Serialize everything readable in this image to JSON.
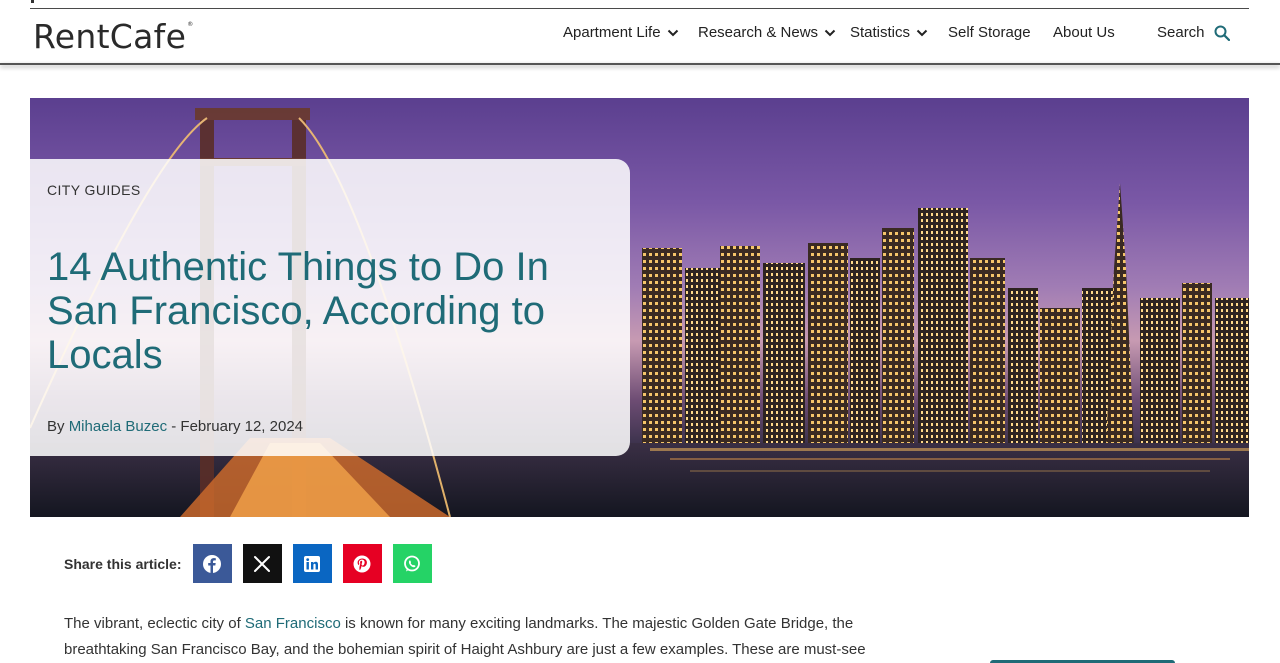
{
  "header": {
    "logo": "RentCafe",
    "logo_mark": "®",
    "nav": [
      {
        "label": "Apartment Life",
        "has_dropdown": true
      },
      {
        "label": "Research & News",
        "has_dropdown": true
      },
      {
        "label": "Statistics",
        "has_dropdown": true
      },
      {
        "label": "Self Storage",
        "has_dropdown": false
      },
      {
        "label": "About Us",
        "has_dropdown": false
      }
    ],
    "search_label": "Search",
    "icons": {
      "dropdown": "chevron-down-icon",
      "search": "search-icon"
    }
  },
  "article": {
    "category": "CITY GUIDES",
    "title": "14 Authentic Things to Do In San Francisco, According to Locals",
    "by": "By",
    "author": "Mihaela Buzec",
    "separator": " - ",
    "date": "February 12, 2024",
    "hero_image": "San Francisco skyline and Bay Bridge at dusk"
  },
  "share": {
    "label": "Share this article:",
    "buttons": [
      {
        "name": "facebook",
        "icon": "facebook-icon",
        "color": "#3b5998"
      },
      {
        "name": "x",
        "icon": "x-icon",
        "color": "#111111"
      },
      {
        "name": "linkedin",
        "icon": "linkedin-icon",
        "color": "#0a66c2"
      },
      {
        "name": "pinterest",
        "icon": "pinterest-icon",
        "color": "#e60023"
      },
      {
        "name": "whatsapp",
        "icon": "whatsapp-icon",
        "color": "#25d366"
      }
    ]
  },
  "intro": {
    "part1": "The vibrant, eclectic city of ",
    "link": "San Francisco",
    "part2": " is known for many exciting landmarks. The majestic Golden Gate Bridge, the breathtaking San Francisco Bay, and the bohemian spirit of Haight Ashbury are just a few examples. These are must-see"
  },
  "colors": {
    "accent": "#1f6b77",
    "text": "#333333"
  }
}
